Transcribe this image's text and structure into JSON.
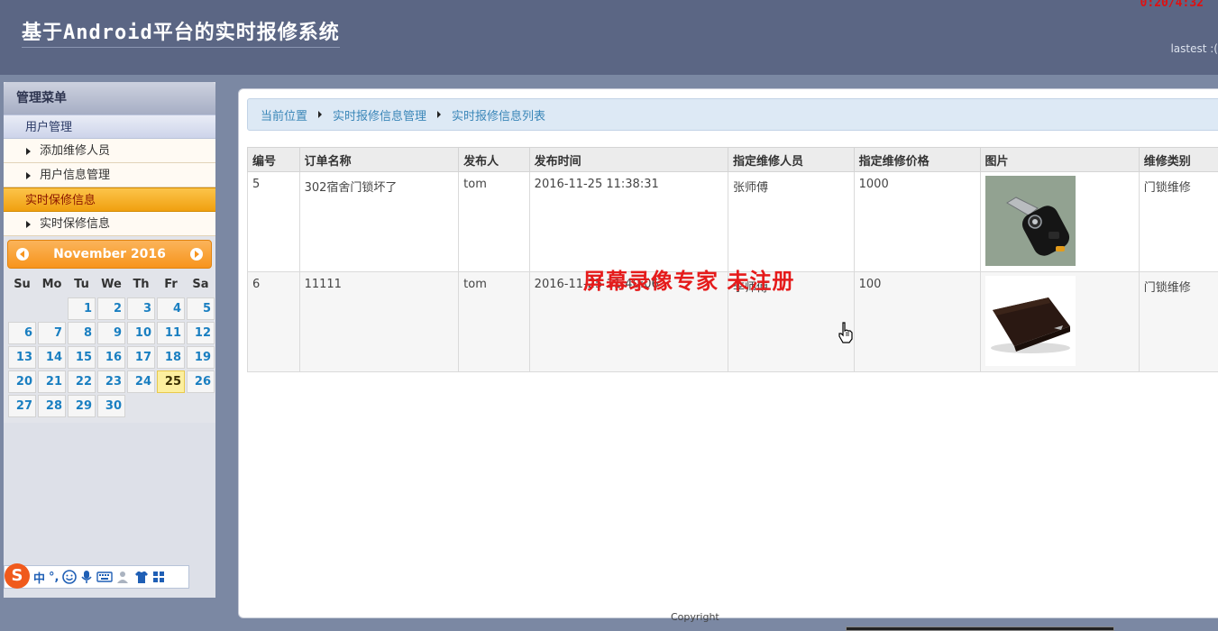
{
  "header": {
    "title": "基于Android平台的实时报修系统",
    "timer": "0:20/4:32",
    "user_info": "lastest :("
  },
  "sidebar": {
    "title": "管理菜单",
    "groups": [
      {
        "label": "用户管理",
        "items": [
          {
            "label": "添加维修人员"
          },
          {
            "label": "用户信息管理"
          }
        ]
      },
      {
        "label": "实时保修信息",
        "items": [
          {
            "label": "实时保修信息"
          }
        ]
      }
    ]
  },
  "calendar": {
    "month_label": "November 2016",
    "weekdays": [
      "Su",
      "Mo",
      "Tu",
      "We",
      "Th",
      "Fr",
      "Sa"
    ],
    "first_weekday": 2,
    "days_in_month": 30,
    "today": 25
  },
  "ime": {
    "logo": "S",
    "mode": "中",
    "punct": "°,"
  },
  "breadcrumb": {
    "items": [
      "当前位置",
      "实时报修信息管理",
      "实时报修信息列表"
    ]
  },
  "table": {
    "columns": [
      "编号",
      "订单名称",
      "发布人",
      "发布时间",
      "指定维修人员",
      "指定维修价格",
      "图片",
      "维修类别"
    ],
    "rows": [
      {
        "id": "5",
        "name": "302宿舍门锁坏了",
        "publisher": "tom",
        "time": "2016-11-25 11:38:31",
        "repairer": "张师傅",
        "price": "1000",
        "image": "car-key-photo",
        "category": "门锁维修"
      },
      {
        "id": "6",
        "name": "11111",
        "publisher": "tom",
        "time": "2016-11-25 11:40:06",
        "repairer": "李师傅",
        "price": "100",
        "image": "wallet-photo",
        "category": "门锁维修"
      }
    ]
  },
  "watermark": "屏幕录像专家 未注册",
  "footer": "Copyright"
}
